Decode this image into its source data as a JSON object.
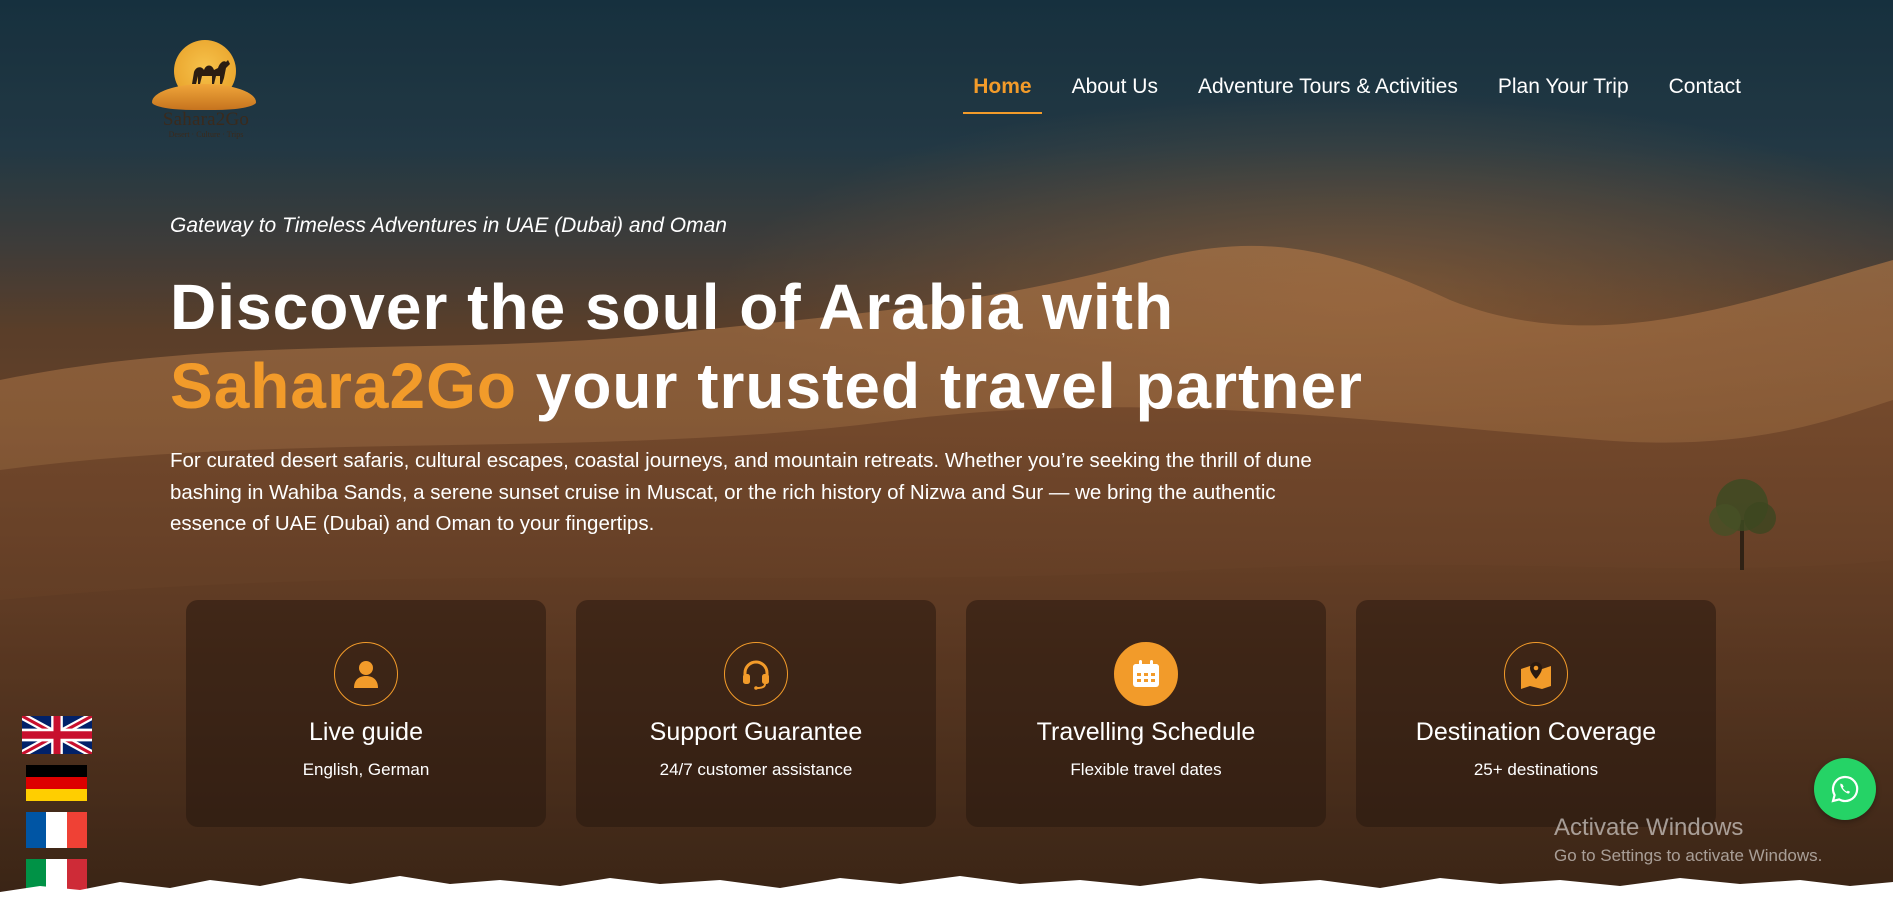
{
  "logo": {
    "name": "Sahara2Go",
    "tagline": "Desert · Culture · Trips"
  },
  "nav": {
    "items": [
      {
        "label": "Home",
        "active": true
      },
      {
        "label": "About Us"
      },
      {
        "label": "Adventure Tours & Activities"
      },
      {
        "label": "Plan Your Trip"
      },
      {
        "label": "Contact"
      }
    ]
  },
  "hero": {
    "tagline": "Gateway to Timeless Adventures in UAE (Dubai) and Oman",
    "headline_line1": "Discover the soul of Arabia with",
    "headline_accent": "Sahara2Go",
    "headline_line2_rest": " your trusted travel partner",
    "description": "For curated desert safaris, cultural escapes, coastal journeys, and mountain retreats. Whether you’re seeking the thrill of dune bashing in Wahiba Sands, a serene sunset cruise in Muscat, or the rich history of Nizwa and Sur — we bring the authentic essence of UAE (Dubai) and Oman to your fingertips."
  },
  "features": [
    {
      "icon": "user-icon",
      "title": "Live guide",
      "subtitle": "English, German"
    },
    {
      "icon": "headset-icon",
      "title": "Support Guarantee",
      "subtitle": "24/7 customer assistance"
    },
    {
      "icon": "calendar-icon",
      "title": "Travelling Schedule",
      "subtitle": "Flexible travel dates"
    },
    {
      "icon": "map-pin-icon",
      "title": "Destination Coverage",
      "subtitle": "25+ destinations"
    }
  ],
  "languages": [
    "uk-flag-icon",
    "germany-flag-icon",
    "france-flag-icon",
    "italy-flag-icon"
  ],
  "whatsapp": {
    "icon": "whatsapp-icon"
  },
  "watermark": {
    "title": "Activate Windows",
    "subtitle": "Go to Settings to activate Windows."
  },
  "colors": {
    "accent": "#f29b2a",
    "whatsapp": "#25d366"
  }
}
